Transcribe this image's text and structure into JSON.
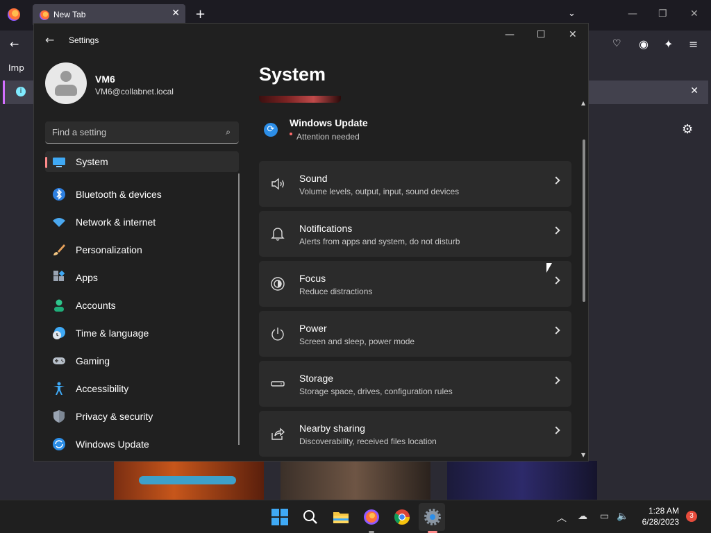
{
  "browser": {
    "tab_title": "New Tab",
    "tab_close": "✕",
    "new_tab": "+",
    "list_tabs": "⌄",
    "bookmark_item": "Imp",
    "infobar_close": "✕"
  },
  "settings": {
    "window_title": "Settings",
    "user": {
      "name": "VM6",
      "email": "VM6@collabnet.local"
    },
    "search_placeholder": "Find a setting",
    "nav": [
      {
        "label": "System",
        "icon": "system-icon",
        "active": true
      },
      {
        "label": "Bluetooth & devices",
        "icon": "bluetooth-icon"
      },
      {
        "label": "Network & internet",
        "icon": "wifi-icon"
      },
      {
        "label": "Personalization",
        "icon": "brush-icon"
      },
      {
        "label": "Apps",
        "icon": "apps-icon"
      },
      {
        "label": "Accounts",
        "icon": "account-icon"
      },
      {
        "label": "Time & language",
        "icon": "clock-globe-icon"
      },
      {
        "label": "Gaming",
        "icon": "gamepad-icon"
      },
      {
        "label": "Accessibility",
        "icon": "accessibility-icon"
      },
      {
        "label": "Privacy & security",
        "icon": "shield-icon"
      },
      {
        "label": "Windows Update",
        "icon": "update-icon"
      }
    ],
    "page_title": "System",
    "windows_update": {
      "title": "Windows Update",
      "status": "Attention needed"
    },
    "cards": [
      {
        "title": "Sound",
        "subtitle": "Volume levels, output, input, sound devices",
        "icon": "speaker-icon"
      },
      {
        "title": "Notifications",
        "subtitle": "Alerts from apps and system, do not disturb",
        "icon": "bell-icon"
      },
      {
        "title": "Focus",
        "subtitle": "Reduce distractions",
        "icon": "focus-icon"
      },
      {
        "title": "Power",
        "subtitle": "Screen and sleep, power mode",
        "icon": "power-icon"
      },
      {
        "title": "Storage",
        "subtitle": "Storage space, drives, configuration rules",
        "icon": "storage-icon"
      },
      {
        "title": "Nearby sharing",
        "subtitle": "Discoverability, received files location",
        "icon": "share-icon"
      }
    ]
  },
  "taskbar": {
    "time": "1:28 AM",
    "date": "6/28/2023",
    "notification_count": "3"
  },
  "colors": {
    "accent": "#ff8a8a",
    "windows_blue": "#3fa9f5",
    "settings_bg": "#202020",
    "card_bg": "#2b2b2b"
  }
}
